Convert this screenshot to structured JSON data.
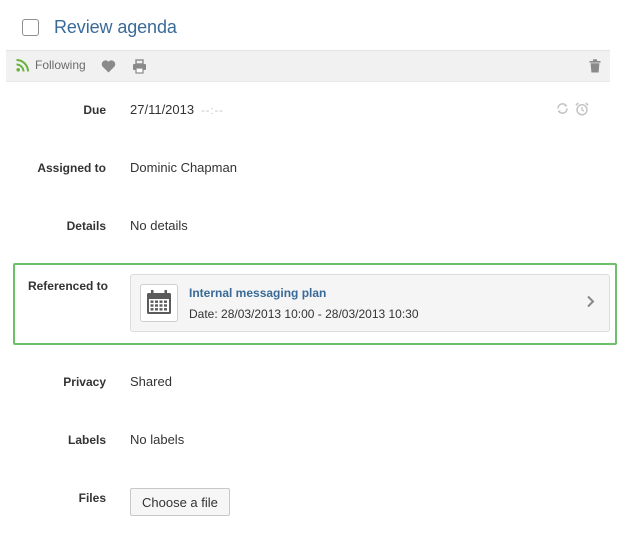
{
  "task": {
    "title": "Review agenda"
  },
  "toolbar": {
    "following_label": "Following",
    "icons": {
      "follow": "rss-icon",
      "like": "heart-icon",
      "print": "printer-icon",
      "delete": "trash-icon"
    },
    "accent_color": "#6ab23f"
  },
  "fields": {
    "due": {
      "label": "Due",
      "date": "27/11/2013",
      "time_placeholder": "--:--"
    },
    "assigned_to": {
      "label": "Assigned to",
      "value": "Dominic Chapman"
    },
    "details": {
      "label": "Details",
      "value": "No details"
    },
    "referenced_to": {
      "label": "Referenced to",
      "title": "Internal messaging plan",
      "date": "Date: 28/03/2013 10:00 - 28/03/2013 10:30",
      "highlight_color": "#6cc06a"
    },
    "privacy": {
      "label": "Privacy",
      "value": "Shared"
    },
    "labels": {
      "label": "Labels",
      "value": "No labels"
    },
    "files": {
      "label": "Files",
      "button_label": "Choose a file"
    }
  }
}
